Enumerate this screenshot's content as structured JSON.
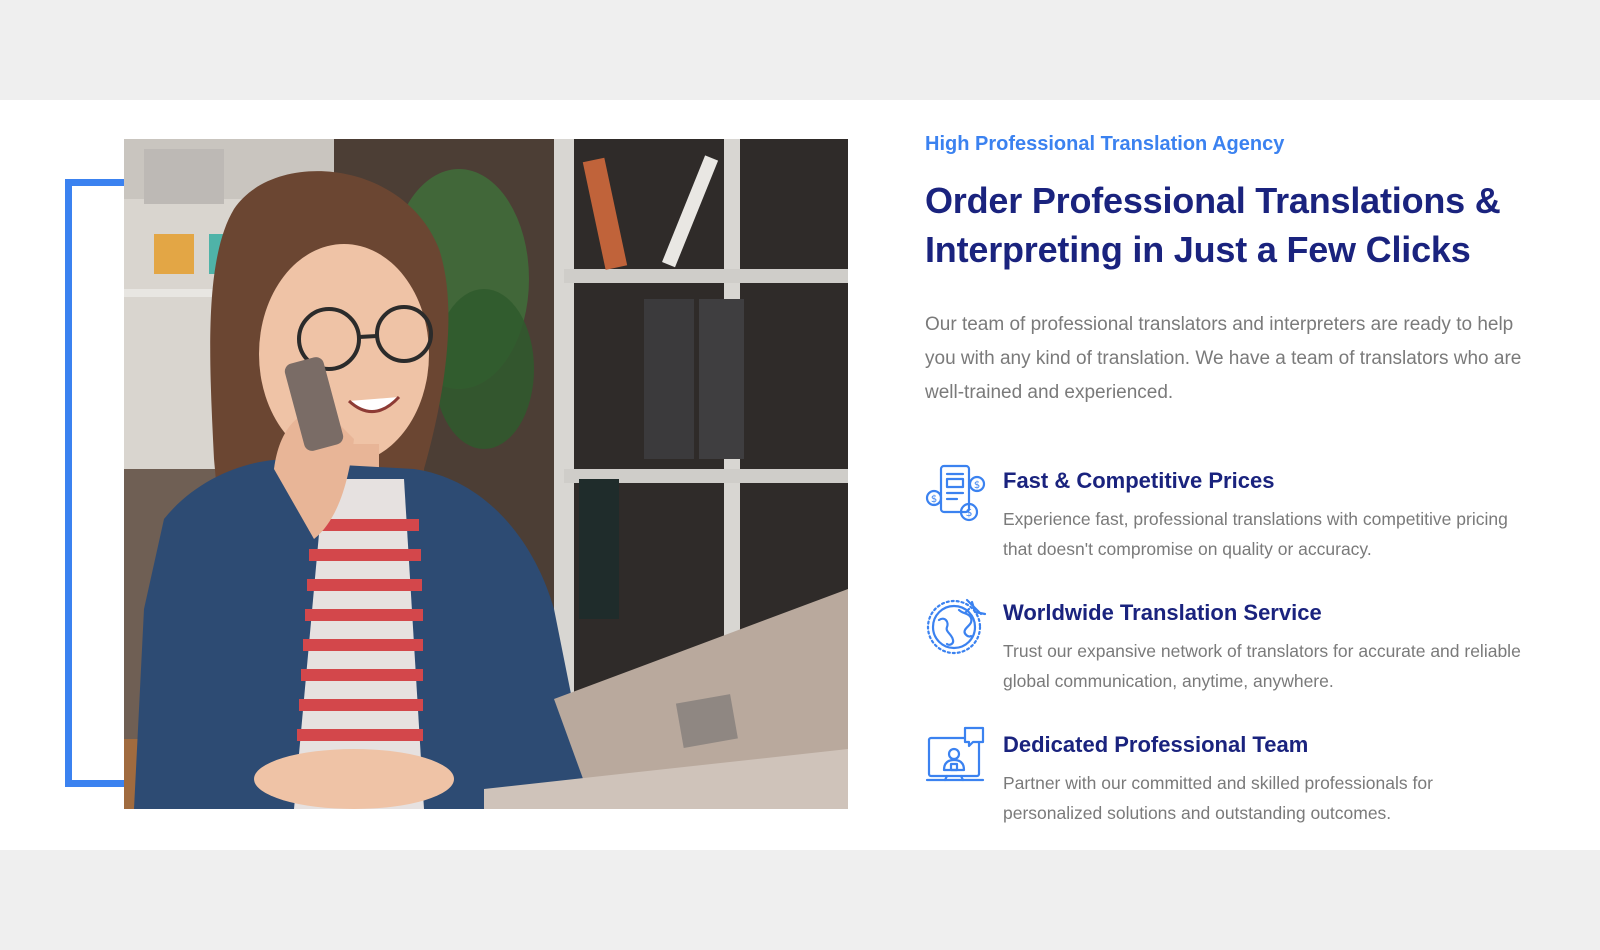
{
  "colors": {
    "accent": "#3b82f0",
    "heading": "#1a237e",
    "body_text": "#7a7a7a",
    "page_background": "#efefef",
    "section_background": "#ffffff"
  },
  "image": {
    "subject": "woman-on-phone-with-laptop"
  },
  "eyebrow": "High Professional Translation Agency",
  "headline": "Order Professional Translations & Interpreting in Just a Few Clicks",
  "intro": "Our team of professional translators and interpreters are ready to help you with any kind of translation. We have a team of translators who are well-trained and experienced.",
  "features": [
    {
      "icon": "price-tag-icon",
      "title": "Fast & Competitive Prices",
      "text": "Experience fast, professional translations with competitive pricing that doesn't compromise on quality or accuracy."
    },
    {
      "icon": "globe-plane-icon",
      "title": "Worldwide Translation Service",
      "text": "Trust our expansive network of translators for accurate and reliable global communication, anytime, anywhere."
    },
    {
      "icon": "team-monitor-icon",
      "title": "Dedicated Professional Team",
      "text": "Partner with our committed and skilled professionals for personalized solutions and outstanding outcomes."
    }
  ]
}
